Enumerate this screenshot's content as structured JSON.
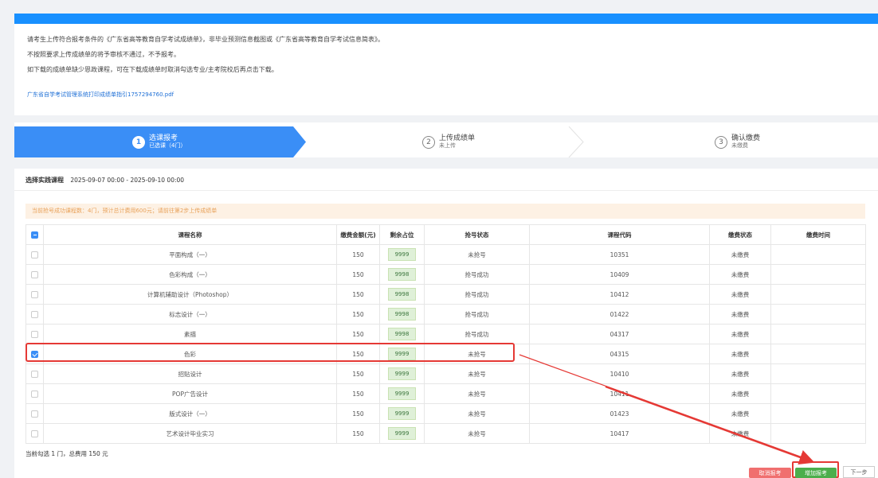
{
  "notice": {
    "line1": "请考生上传符合报考条件的《广东省高等教育自学考试成绩单》，非毕业预测信息截图或《广东省高等教育自学考试信息简表》。",
    "line2": "不按照要求上传成绩单的将予审核不通过，不予报考。",
    "line3": "如下载的成绩单缺少恩政课程，可在下载成绩单时取消勾选专业/主考院校后再点击下载。",
    "link": "广东省自学考试管理系统打印成绩单指引1757294760.pdf"
  },
  "steps": [
    {
      "num": "1",
      "title": "选课报考",
      "sub": "已选课（4门）"
    },
    {
      "num": "2",
      "title": "上传成绩单",
      "sub": "未上传"
    },
    {
      "num": "3",
      "title": "确认缴费",
      "sub": "未缴费"
    }
  ],
  "panel": {
    "title": "选择实践课程",
    "period": "2025-09-07 00:00 - 2025-09-10 00:00",
    "alert": "当前抢号成功课程数：4门，预计总计费用600元；请前往第2步上传成绩单"
  },
  "table": {
    "headers": [
      "课程名称",
      "缴费金额(元)",
      "剩余占位",
      "抢号状态",
      "课程代码",
      "缴费状态",
      "缴费时间"
    ],
    "rows": [
      {
        "name": "平面构成（一）",
        "fee": "150",
        "seats": "9999",
        "status": "未抢号",
        "code": "10351",
        "pay": "未缴费",
        "time": ""
      },
      {
        "name": "色彩构成（一）",
        "fee": "150",
        "seats": "9998",
        "status": "抢号成功",
        "code": "10409",
        "pay": "未缴费",
        "time": ""
      },
      {
        "name": "计算机辅助设计（Photoshop）",
        "fee": "150",
        "seats": "9998",
        "status": "抢号成功",
        "code": "10412",
        "pay": "未缴费",
        "time": ""
      },
      {
        "name": "标志设计（一）",
        "fee": "150",
        "seats": "9998",
        "status": "抢号成功",
        "code": "01422",
        "pay": "未缴费",
        "time": ""
      },
      {
        "name": "素描",
        "fee": "150",
        "seats": "9998",
        "status": "抢号成功",
        "code": "04317",
        "pay": "未缴费",
        "time": ""
      },
      {
        "name": "色彩",
        "fee": "150",
        "seats": "9999",
        "status": "未抢号",
        "code": "04315",
        "pay": "未缴费",
        "time": ""
      },
      {
        "name": "招贴设计",
        "fee": "150",
        "seats": "9999",
        "status": "未抢号",
        "code": "10410",
        "pay": "未缴费",
        "time": ""
      },
      {
        "name": "POP广告设计",
        "fee": "150",
        "seats": "9999",
        "status": "未抢号",
        "code": "10411",
        "pay": "未缴费",
        "time": ""
      },
      {
        "name": "版式设计（一）",
        "fee": "150",
        "seats": "9999",
        "status": "未抢号",
        "code": "01423",
        "pay": "未缴费",
        "time": ""
      },
      {
        "name": "艺术设计毕业实习",
        "fee": "150",
        "seats": "9999",
        "status": "未抢号",
        "code": "10417",
        "pay": "未缴费",
        "time": ""
      }
    ],
    "checked_row": 5
  },
  "summary": "当前勾选 1 门，总费用 150 元",
  "buttons": {
    "cancel": "取消报考",
    "add": "增加报考",
    "next": "下一步"
  },
  "colors": {
    "primary": "#3a8ef6",
    "success": "#4cae4c",
    "danger": "#d9534f",
    "annotation": "#e53935"
  }
}
